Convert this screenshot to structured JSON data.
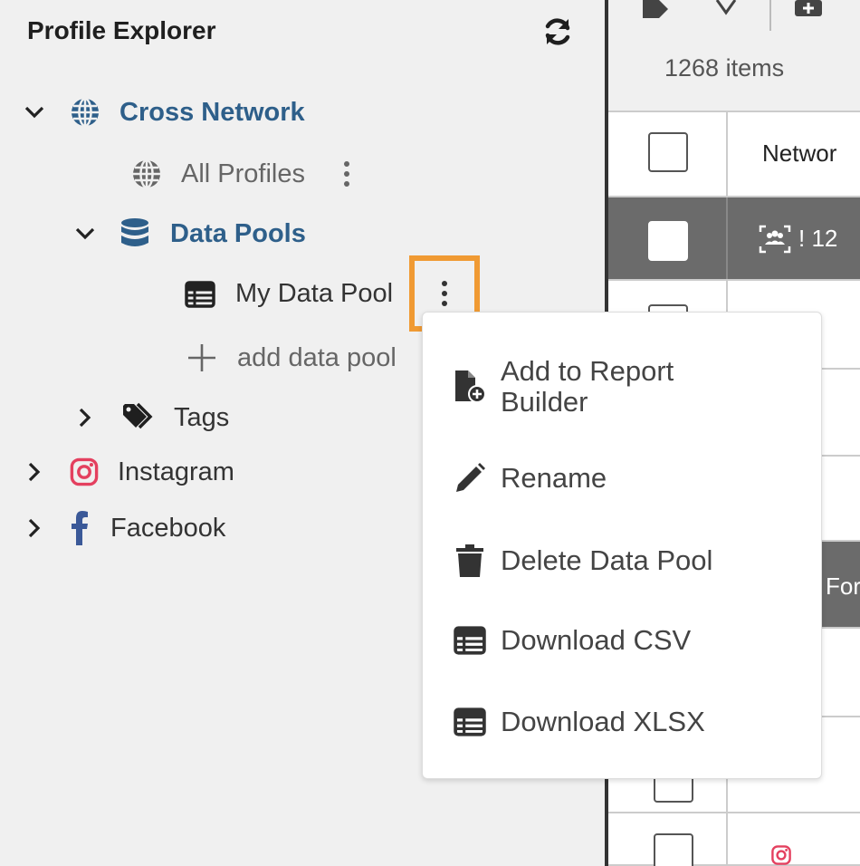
{
  "sidebar": {
    "title": "Profile Explorer",
    "tree": {
      "cross_network": "Cross Network",
      "all_profiles": "All Profiles",
      "data_pools": "Data Pools",
      "my_data_pool": "My Data Pool",
      "add_data_pool": "add data pool",
      "tags": "Tags",
      "instagram": "Instagram",
      "facebook": "Facebook"
    }
  },
  "table": {
    "count": "1268 items",
    "header_network": "Networ",
    "row_label": "! 12",
    "row_partial": "For"
  },
  "context_menu": {
    "items": [
      {
        "label_line1": "Add to Report",
        "label_line2": "Builder",
        "icon": "file-add-icon"
      },
      {
        "label": "Rename",
        "icon": "pencil-icon"
      },
      {
        "label": "Delete Data Pool",
        "icon": "trash-icon"
      },
      {
        "label": "Download CSV",
        "icon": "table-icon"
      },
      {
        "label": "Download XLSX",
        "icon": "table-icon"
      }
    ]
  },
  "colors": {
    "accent_blue": "#2e5f8a",
    "highlight_orange": "#f09a33",
    "instagram": "#e4405f",
    "facebook": "#3b5998"
  }
}
